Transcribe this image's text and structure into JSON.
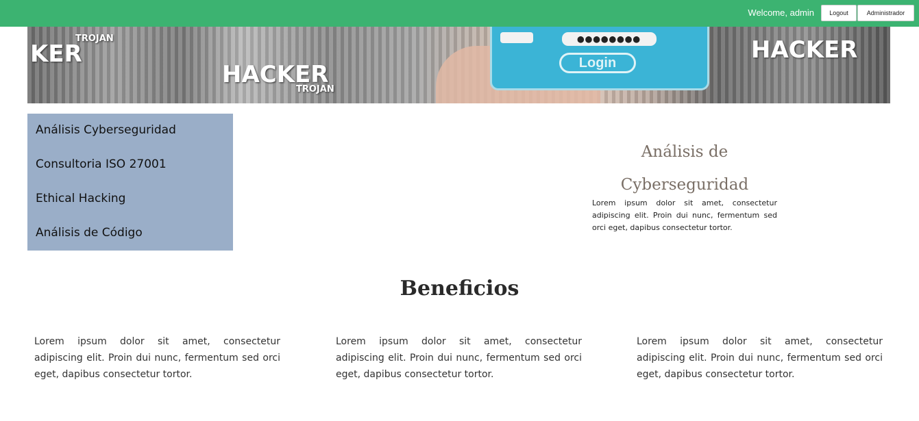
{
  "topbar": {
    "welcome": "Welcome, admin",
    "logout_label": "Logout",
    "admin_label": "Administrador",
    "color": "#3cb371"
  },
  "banner": {
    "texts": [
      "KER",
      "TROJAN",
      "HACKER",
      "TROJAN",
      "HACKER",
      "HACKER"
    ],
    "password_mask": "●●●●●●●●",
    "login_label": "Login"
  },
  "sidebar": {
    "color": "#9aaec8",
    "items": [
      {
        "label": "Análisis Cyberseguridad"
      },
      {
        "label": "Consultoria ISO 27001"
      },
      {
        "label": "Ethical Hacking"
      },
      {
        "label": "Análisis de Código"
      }
    ]
  },
  "card": {
    "title": "Análisis de Cyberseguridad",
    "text": "Lorem ipsum dolor sit amet, consectetur adipiscing elit. Proin dui nunc, fermentum sed orci eget, dapibus consectetur tortor."
  },
  "benefits": {
    "title": "Beneficios",
    "columns": [
      {
        "text": "Lorem ipsum dolor sit amet, consectetur adipiscing elit. Proin dui nunc, fermentum sed orci eget, dapibus consectetur tortor."
      },
      {
        "text": "Lorem ipsum dolor sit amet, consectetur adipiscing elit. Proin dui nunc, fermentum sed orci eget, dapibus consectetur tortor."
      },
      {
        "text": "Lorem ipsum dolor sit amet, consectetur adipiscing elit. Proin dui nunc, fermentum sed orci eget, dapibus consectetur tortor."
      }
    ]
  }
}
